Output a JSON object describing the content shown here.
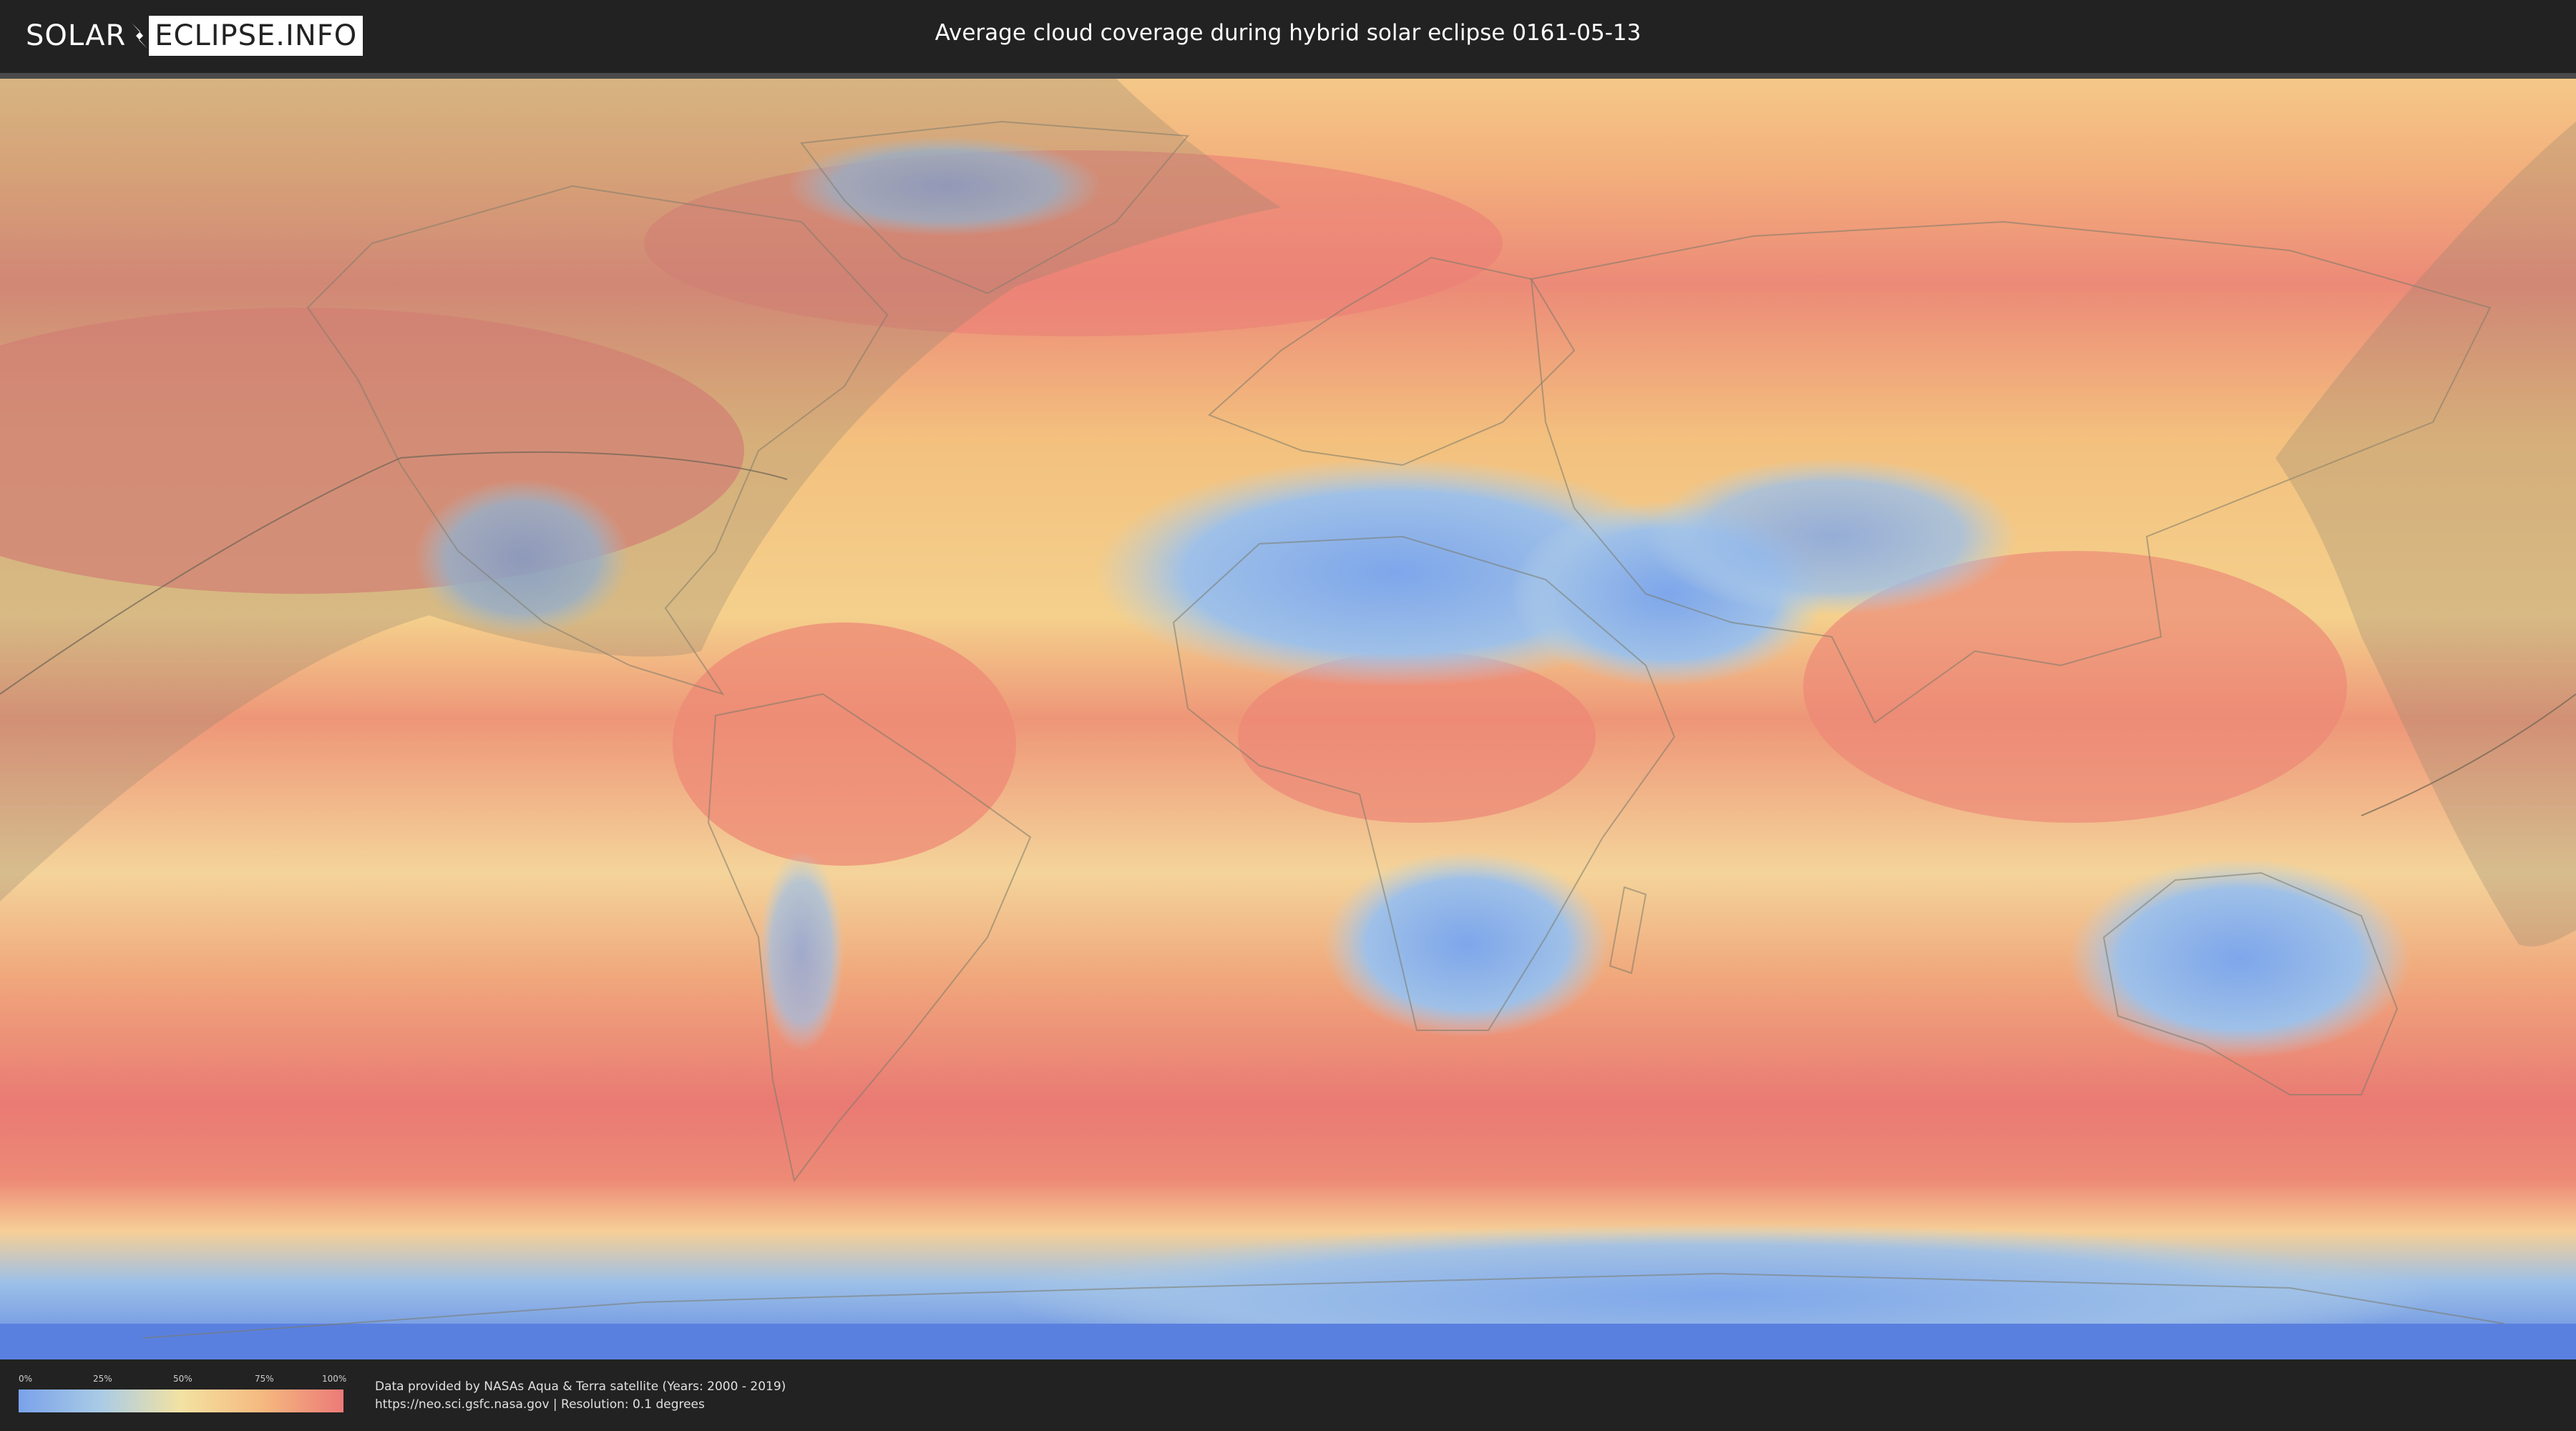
{
  "header": {
    "logo_left": "SOLAR",
    "logo_right": "ECLIPSE.INFO",
    "title": "Average cloud coverage during hybrid solar eclipse 0161-05-13"
  },
  "legend": {
    "ticks": [
      "0%",
      "25%",
      "50%",
      "75%",
      "100%"
    ],
    "colors": [
      "#7aa2ea",
      "#a9cbe6",
      "#f3e2a2",
      "#f5b97f",
      "#ec7a78"
    ]
  },
  "footer": {
    "credit_line": "Data provided by NASAs Aqua & Terra satellite (Years: 2000 - 2019)",
    "source_line": "https://neo.sci.gsfc.nasa.gov | Resolution: 0.1 degrees"
  },
  "map": {
    "background_color": "#f0a070",
    "ocean_cloud_color": "#ec7a78",
    "clear_land_color": "#7aa2ea",
    "shadow_overlay_color": "#8c8070"
  }
}
